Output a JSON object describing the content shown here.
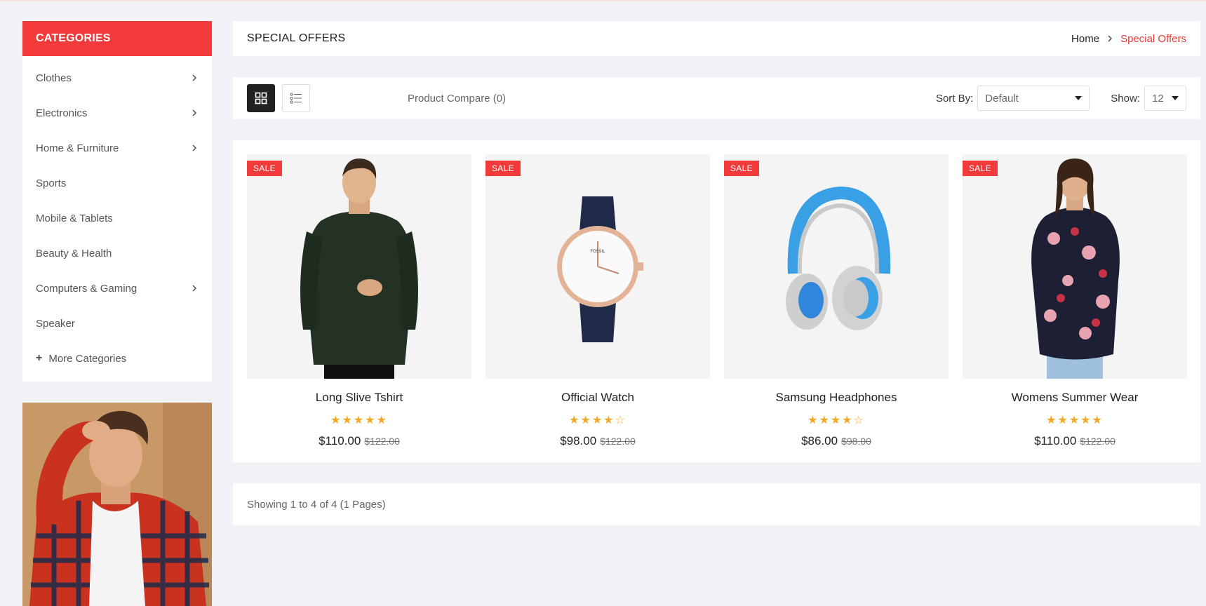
{
  "sidebar": {
    "header": "CATEGORIES",
    "items": [
      {
        "label": "Clothes",
        "has_children": true
      },
      {
        "label": "Electronics",
        "has_children": true
      },
      {
        "label": "Home & Furniture",
        "has_children": true
      },
      {
        "label": "Sports",
        "has_children": false
      },
      {
        "label": "Mobile & Tablets",
        "has_children": false
      },
      {
        "label": "Beauty & Health",
        "has_children": false
      },
      {
        "label": "Computers & Gaming",
        "has_children": true
      },
      {
        "label": "Speaker",
        "has_children": false
      }
    ],
    "more": "More Categories"
  },
  "page": {
    "title": "SPECIAL OFFERS",
    "breadcrumb": {
      "home": "Home",
      "current": "Special Offers"
    }
  },
  "toolbar": {
    "compare": "Product Compare (0)",
    "sort_label": "Sort By:",
    "sort_value": "Default",
    "show_label": "Show:",
    "show_value": "12"
  },
  "products": [
    {
      "name": "Long Slive Tshirt",
      "rating": 5,
      "price": "$110.00",
      "old_price": "$122.00",
      "badge": "SALE"
    },
    {
      "name": "Official Watch",
      "rating": 4,
      "price": "$98.00",
      "old_price": "$122.00",
      "badge": "SALE"
    },
    {
      "name": "Samsung Headphones",
      "rating": 4,
      "price": "$86.00",
      "old_price": "$98.00",
      "badge": "SALE"
    },
    {
      "name": "Womens Summer Wear",
      "rating": 5,
      "price": "$110.00",
      "old_price": "$122.00",
      "badge": "SALE"
    }
  ],
  "pagination": {
    "summary": "Showing 1 to 4 of 4 (1 Pages)"
  },
  "colors": {
    "accent": "#f33a3a",
    "star": "#f5a623",
    "background": "#f1f2f6"
  }
}
